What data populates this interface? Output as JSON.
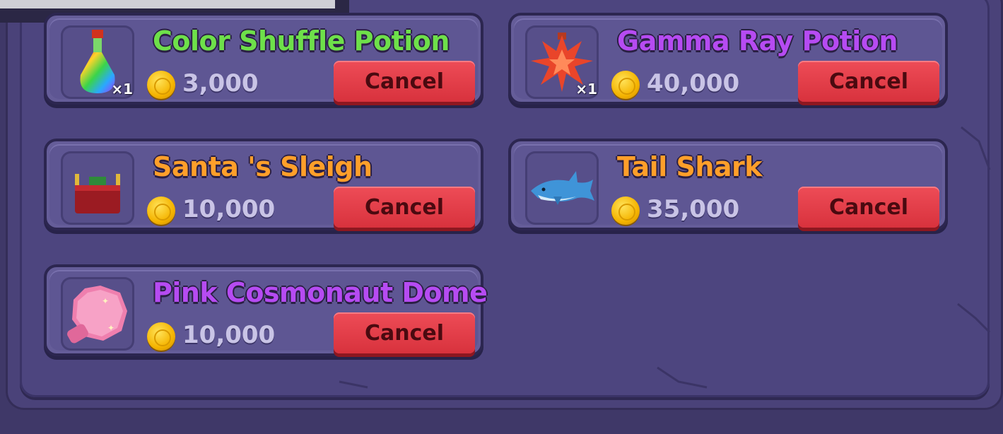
{
  "items": [
    {
      "name": "Color Shuffle Potion",
      "name_color": "#6ee04a",
      "price": "3,000",
      "qty": "×1",
      "cancel_label": "Cancel",
      "icon": "rainbow-potion-icon"
    },
    {
      "name": "Gamma Ray Potion",
      "name_color": "#b64bf2",
      "price": "40,000",
      "qty": "×1",
      "cancel_label": "Cancel",
      "icon": "gamma-potion-icon"
    },
    {
      "name": "Santa 's Sleigh",
      "name_color": "#ff9f2a",
      "price": "10,000",
      "qty": "",
      "cancel_label": "Cancel",
      "icon": "sleigh-icon"
    },
    {
      "name": "Tail Shark",
      "name_color": "#ff9f2a",
      "price": "35,000",
      "qty": "",
      "cancel_label": "Cancel",
      "icon": "shark-icon"
    },
    {
      "name": "Pink Cosmonaut Dome",
      "name_color": "#b64bf2",
      "price": "10,000",
      "qty": "",
      "cancel_label": "Cancel",
      "icon": "pink-dome-icon"
    }
  ]
}
